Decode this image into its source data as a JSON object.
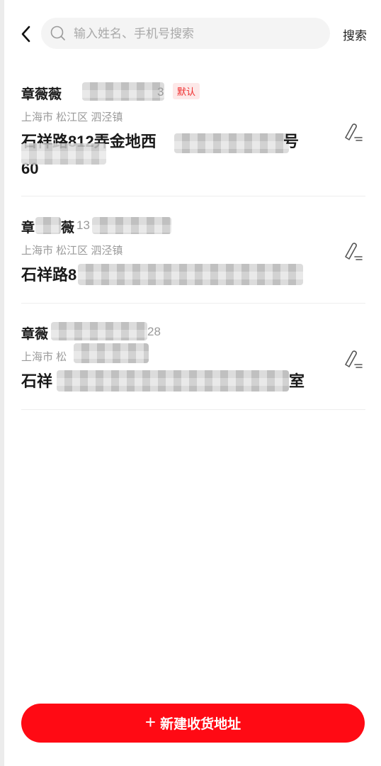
{
  "header": {
    "search_placeholder": "输入姓名、手机号搜索",
    "search_button": "搜索"
  },
  "addresses": [
    {
      "name": "章薇薇",
      "phone_visible": "3",
      "default_tag": "默认",
      "region": "上海市 松江区 泗泾镇",
      "detail": "石祥路812弄金地西",
      "detail_end": "号",
      "detail_line2": "60"
    },
    {
      "name_first": "章",
      "name_last": "薇",
      "phone_visible": "13",
      "region": "上海市 松江区 泗泾镇",
      "detail": "石祥路8"
    },
    {
      "name": "章薇",
      "phone_visible": "28",
      "region": "上海市 松",
      "detail": "石祥",
      "detail_end": "室"
    }
  ],
  "footer": {
    "add_button_plus": "+",
    "add_button_label": "新建收货地址"
  },
  "colors": {
    "accent": "#ff0a14",
    "tag_text": "#ef2b2b",
    "tag_bg": "#fde8e8"
  },
  "icons": {
    "back": "chevron-left-icon",
    "search": "search-icon",
    "edit": "edit-icon"
  }
}
